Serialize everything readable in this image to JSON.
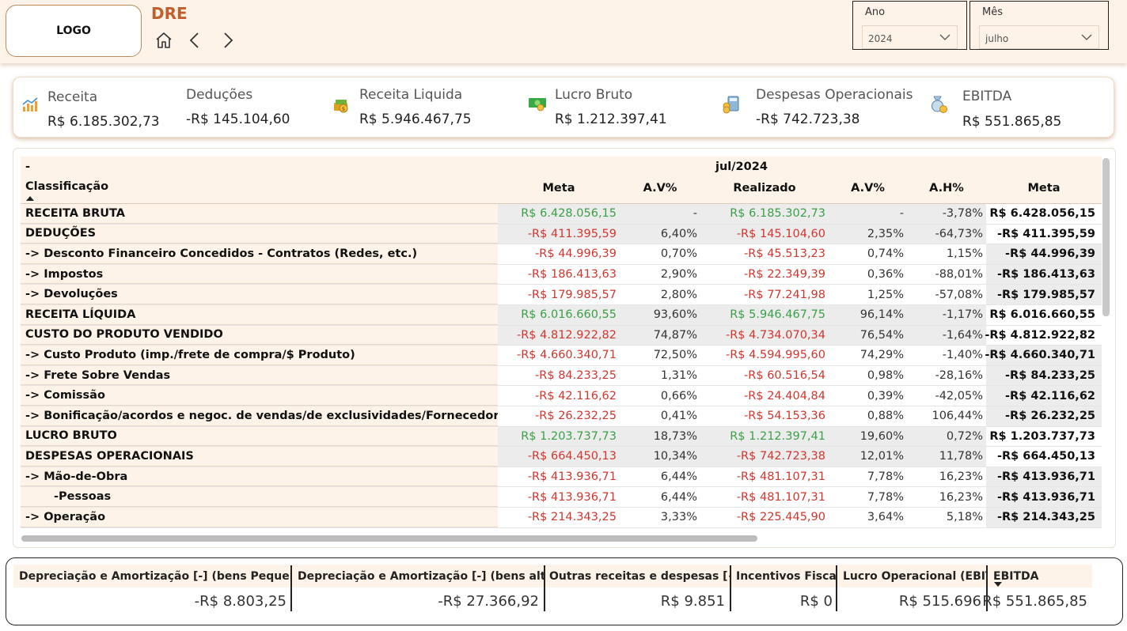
{
  "header": {
    "logo": "LOGO",
    "title": "DRE"
  },
  "filters": {
    "ano": {
      "label": "Ano",
      "value": "2024"
    },
    "mes": {
      "label": "Mês",
      "value": "julho"
    }
  },
  "kpis": [
    {
      "label": "Receita",
      "value": "R$ 6.185.302,73",
      "icon": "bar-chart-icon"
    },
    {
      "label": "Deduções",
      "value": "-R$ 145.104,60",
      "icon": ""
    },
    {
      "label": "Receita Liquida",
      "value": "R$ 5.946.467,75",
      "icon": "money-stack-icon"
    },
    {
      "label": "Lucro Bruto",
      "value": "R$ 1.212.397,41",
      "icon": "banknote-icon"
    },
    {
      "label": "Despesas Operacionais",
      "value": "-R$ 742.723,38",
      "icon": "calculator-coins-icon"
    },
    {
      "label": "EBITDA",
      "value": "R$ 551.865,85",
      "icon": "money-bag-icon"
    }
  ],
  "matrix": {
    "col_header_top": {
      "left": "-",
      "period": "jul/2024"
    },
    "columns": [
      "Classificação",
      "Meta",
      "A.V%",
      "Realizado",
      "A.V%",
      "A.H%",
      "Meta"
    ],
    "rows": [
      {
        "cls": "RECEITA BRUTA",
        "meta": "R$ 6.428.056,15",
        "av1": "-",
        "real": "R$ 6.185.302,73",
        "av2": "-",
        "ah": "-3,78%",
        "meta2": "R$ 6.428.056,15",
        "sign": "pos",
        "shade": "grey",
        "level": 0
      },
      {
        "cls": "DEDUÇÕES",
        "meta": "-R$ 411.395,59",
        "av1": "6,40%",
        "real": "-R$ 145.104,60",
        "av2": "2,35%",
        "ah": "-64,73%",
        "meta2": "-R$ 411.395,59",
        "sign": "neg",
        "shade": "grey",
        "level": 0
      },
      {
        "cls": "-> Desconto Financeiro Concedidos - Contratos (Redes, etc.)",
        "meta": "-R$ 44.996,39",
        "av1": "0,70%",
        "real": "-R$ 45.513,23",
        "av2": "0,74%",
        "ah": "1,15%",
        "meta2": "-R$ 44.996,39",
        "sign": "neg",
        "shade": "white",
        "level": 1
      },
      {
        "cls": "-> Impostos",
        "meta": "-R$ 186.413,63",
        "av1": "2,90%",
        "real": "-R$ 22.349,39",
        "av2": "0,36%",
        "ah": "-88,01%",
        "meta2": "-R$ 186.413,63",
        "sign": "neg",
        "shade": "white",
        "level": 1
      },
      {
        "cls": "-> Devoluções",
        "meta": "-R$ 179.985,57",
        "av1": "2,80%",
        "real": "-R$ 77.241,98",
        "av2": "1,25%",
        "ah": "-57,08%",
        "meta2": "-R$ 179.985,57",
        "sign": "neg",
        "shade": "white",
        "level": 1
      },
      {
        "cls": "RECEITA LÍQUIDA",
        "meta": "R$ 6.016.660,55",
        "av1": "93,60%",
        "real": "R$ 5.946.467,75",
        "av2": "96,14%",
        "ah": "-1,17%",
        "meta2": "R$ 6.016.660,55",
        "sign": "pos",
        "shade": "grey",
        "level": 0
      },
      {
        "cls": "CUSTO DO PRODUTO VENDIDO",
        "meta": "-R$ 4.812.922,82",
        "av1": "74,87%",
        "real": "-R$ 4.734.070,34",
        "av2": "76,54%",
        "ah": "-1,64%",
        "meta2": "-R$ 4.812.922,82",
        "sign": "neg",
        "shade": "grey",
        "level": 0
      },
      {
        "cls": "-> Custo Produto (imp./frete de compra/$ Produto)",
        "meta": "-R$ 4.660.340,71",
        "av1": "72,50%",
        "real": "-R$ 4.594.995,60",
        "av2": "74,29%",
        "ah": "-1,40%",
        "meta2": "-R$ 4.660.340,71",
        "sign": "neg",
        "shade": "white",
        "level": 1
      },
      {
        "cls": "-> Frete Sobre Vendas",
        "meta": "-R$ 84.233,25",
        "av1": "1,31%",
        "real": "-R$ 60.516,54",
        "av2": "0,98%",
        "ah": "-28,16%",
        "meta2": "-R$ 84.233,25",
        "sign": "neg",
        "shade": "white",
        "level": 1
      },
      {
        "cls": "-> Comissão",
        "meta": "-R$ 42.116,62",
        "av1": "0,66%",
        "real": "-R$ 24.404,84",
        "av2": "0,39%",
        "ah": "-42,05%",
        "meta2": "-R$ 42.116,62",
        "sign": "neg",
        "shade": "white",
        "level": 1
      },
      {
        "cls": "-> Bonificação/acordos e negoc. de vendas/de exclusividades/Fornecedores",
        "meta": "-R$ 26.232,25",
        "av1": "0,41%",
        "real": "-R$ 54.153,36",
        "av2": "0,88%",
        "ah": "106,44%",
        "meta2": "-R$ 26.232,25",
        "sign": "neg",
        "shade": "white",
        "level": 1
      },
      {
        "cls": "LUCRO BRUTO",
        "meta": "R$ 1.203.737,73",
        "av1": "18,73%",
        "real": "R$ 1.212.397,41",
        "av2": "19,60%",
        "ah": "0,72%",
        "meta2": "R$ 1.203.737,73",
        "sign": "pos",
        "shade": "grey",
        "level": 0
      },
      {
        "cls": "DESPESAS OPERACIONAIS",
        "meta": "-R$ 664.450,13",
        "av1": "10,34%",
        "real": "-R$ 742.723,38",
        "av2": "12,01%",
        "ah": "11,78%",
        "meta2": "-R$ 664.450,13",
        "sign": "neg",
        "shade": "grey",
        "level": 0
      },
      {
        "cls": "-> Mão-de-Obra",
        "meta": "-R$ 413.936,71",
        "av1": "6,44%",
        "real": "-R$ 481.107,31",
        "av2": "7,78%",
        "ah": "16,23%",
        "meta2": "-R$ 413.936,71",
        "sign": "neg",
        "shade": "white",
        "level": 1
      },
      {
        "cls": "-Pessoas",
        "meta": "-R$ 413.936,71",
        "av1": "6,44%",
        "real": "-R$ 481.107,31",
        "av2": "7,78%",
        "ah": "16,23%",
        "meta2": "-R$ 413.936,71",
        "sign": "neg",
        "shade": "white",
        "level": 2
      },
      {
        "cls": "-> Operação",
        "meta": "-R$ 214.343,25",
        "av1": "3,33%",
        "real": "-R$ 225.445,90",
        "av2": "3,64%",
        "ah": "5,18%",
        "meta2": "-R$ 214.343,25",
        "sign": "neg",
        "shade": "white",
        "level": 1
      }
    ]
  },
  "bottom_table": {
    "columns": [
      {
        "header": "Depreciação e Amortização [-] (bens Pequeno $)",
        "value": "-R$ 8.803,25"
      },
      {
        "header": "Depreciação e Amortização [-] (bens alto $)",
        "value": "-R$ 27.366,92"
      },
      {
        "header": "Outras receitas e despesas [+/-]",
        "value": "R$ 9.851"
      },
      {
        "header": "Incentivos Fiscais",
        "value": "R$ 0"
      },
      {
        "header": "Lucro Operacional (EBIT)",
        "value": "R$ 515.696"
      },
      {
        "header": "EBITDA",
        "value": "R$ 551.865,85"
      }
    ]
  }
}
